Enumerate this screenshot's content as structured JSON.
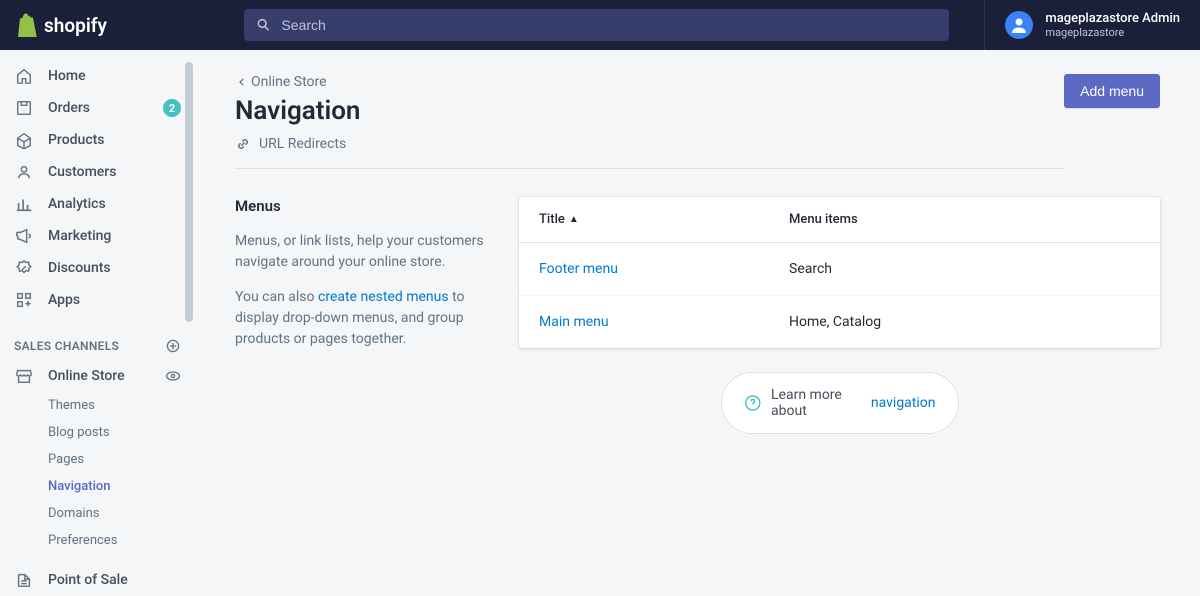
{
  "header": {
    "brand": "shopify",
    "search_placeholder": "Search",
    "user": {
      "name": "mageplazastore Admin",
      "sub": "mageplazastore"
    }
  },
  "sidebar": {
    "items": [
      {
        "label": "Home"
      },
      {
        "label": "Orders",
        "badge": "2"
      },
      {
        "label": "Products"
      },
      {
        "label": "Customers"
      },
      {
        "label": "Analytics"
      },
      {
        "label": "Marketing"
      },
      {
        "label": "Discounts"
      },
      {
        "label": "Apps"
      }
    ],
    "section_header": "SALES CHANNELS",
    "channel": {
      "label": "Online Store"
    },
    "subitems": [
      {
        "label": "Themes"
      },
      {
        "label": "Blog posts"
      },
      {
        "label": "Pages"
      },
      {
        "label": "Navigation"
      },
      {
        "label": "Domains"
      },
      {
        "label": "Preferences"
      }
    ],
    "pos": {
      "label": "Point of Sale"
    }
  },
  "content": {
    "breadcrumb": "Online Store",
    "title": "Navigation",
    "url_redirects": "URL Redirects",
    "add_menu_btn": "Add menu",
    "menus_section": {
      "title": "Menus",
      "desc1_a": "Menus, or link lists, help your customers navigate around your online store.",
      "desc2_a": "You can also ",
      "desc2_link": "create nested menus",
      "desc2_b": " to display drop-down menus, and group products or pages together."
    },
    "menus_table": {
      "col_title": "Title",
      "col_items": "Menu items",
      "rows": [
        {
          "title": "Footer menu",
          "items": "Search"
        },
        {
          "title": "Main menu",
          "items": "Home, Catalog"
        }
      ]
    },
    "learn_more": {
      "prefix": "Learn more about ",
      "link": "navigation"
    }
  }
}
